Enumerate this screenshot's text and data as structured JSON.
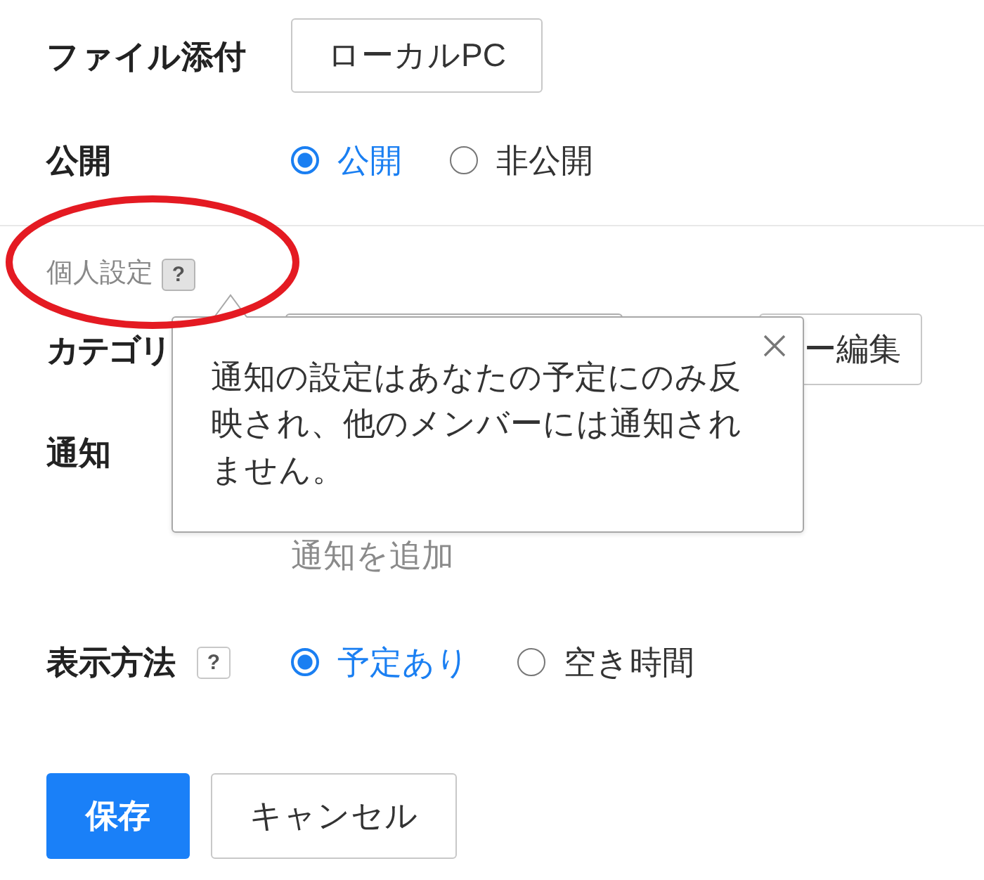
{
  "form": {
    "attachment": {
      "label": "ファイル添付",
      "button": "ローカルPC"
    },
    "visibility": {
      "label": "公開",
      "options": [
        {
          "label": "公開",
          "selected": true
        },
        {
          "label": "非公開",
          "selected": false
        }
      ]
    },
    "personal_settings": {
      "heading": "個人設定",
      "help": {
        "text": "?",
        "active": true
      }
    },
    "category": {
      "label": "カテゴリ",
      "edit_button": "ー編集"
    },
    "notification": {
      "label": "通知",
      "add_link": "通知を追加"
    },
    "display": {
      "label": "表示方法",
      "help": {
        "text": "?",
        "active": false
      },
      "options": [
        {
          "label": "予定あり",
          "selected": true
        },
        {
          "label": "空き時間",
          "selected": false
        }
      ]
    }
  },
  "tooltip": {
    "message": "通知の設定はあなたの予定にのみ反映され、他のメンバーには通知されません。"
  },
  "buttons": [
    {
      "label": "保存",
      "kind": "primary"
    },
    {
      "label": "キャンセル",
      "kind": "secondary"
    }
  ],
  "annotation": {
    "kind": "ellipse"
  }
}
